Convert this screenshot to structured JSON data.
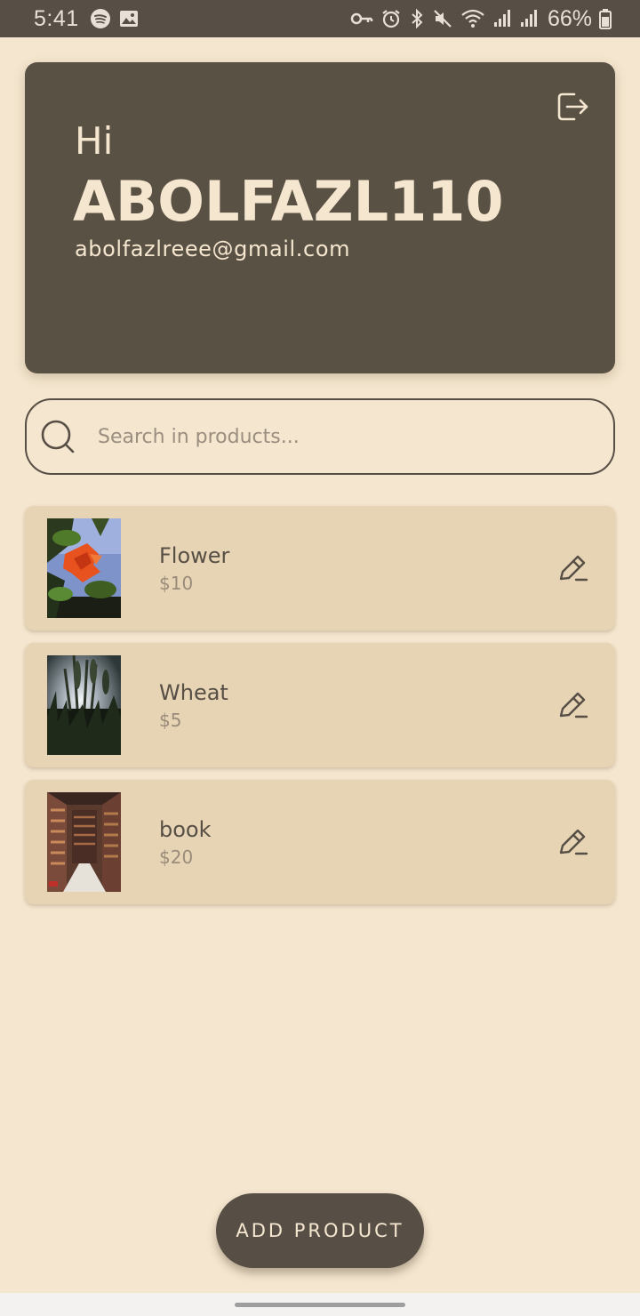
{
  "status_bar": {
    "time": "5:41",
    "battery": "66%",
    "left_icons": [
      "spotify-icon",
      "image-icon"
    ],
    "right_icons": [
      "key-icon",
      "alarm-icon",
      "bluetooth-icon",
      "mute-icon",
      "wifi-icon",
      "signal-icon",
      "signal-icon",
      "battery-icon"
    ]
  },
  "header": {
    "greeting": "Hi",
    "username": "ABOLFAZL110",
    "email": "abolfazlreee@gmail.com",
    "logout_icon": "logout-icon"
  },
  "search": {
    "placeholder": "Search in products...",
    "value": ""
  },
  "products": [
    {
      "name": "Flower",
      "price": "$10"
    },
    {
      "name": "Wheat",
      "price": "$5"
    },
    {
      "name": "book",
      "price": "$20"
    }
  ],
  "add_button": {
    "label": "ADD PRODUCT"
  },
  "colors": {
    "background": "#F5E6CF",
    "primary": "#574F45",
    "card": "#E7D4B5",
    "price": "#9A8C7A"
  }
}
